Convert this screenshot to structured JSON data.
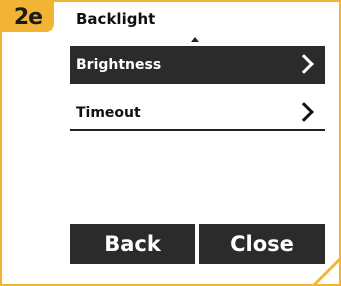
{
  "step_badge": "2e",
  "screen": {
    "title": "Backlight",
    "menu": [
      {
        "label": "Brightness",
        "selected": true
      },
      {
        "label": "Timeout",
        "selected": false
      }
    ]
  },
  "soft_keys": {
    "back_label": "Back",
    "close_label": "Close"
  },
  "colors": {
    "accent": "#f1b434",
    "dark": "#2b2b2b"
  },
  "icons": {
    "scroll_up": "triangle-up-icon",
    "row_chevron": "chevron-right-icon"
  }
}
